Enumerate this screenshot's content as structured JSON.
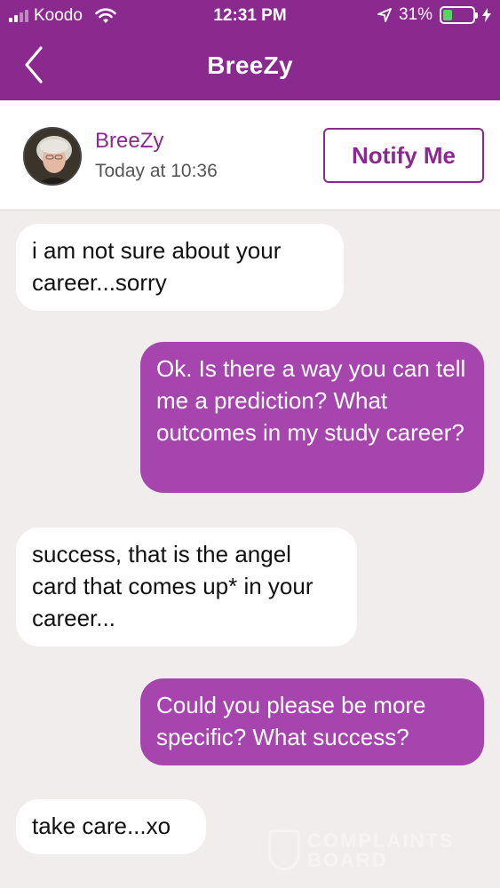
{
  "status_bar": {
    "carrier": "Koodo",
    "time": "12:31 PM",
    "battery_percent": "31%",
    "battery_level": 0.31,
    "icons": [
      "signal-icon",
      "wifi-icon",
      "location-arrow-icon",
      "battery-icon",
      "charging-bolt-icon"
    ]
  },
  "nav": {
    "title": "BreeZy",
    "back_icon": "chevron-left-icon"
  },
  "header": {
    "sender_name": "BreeZy",
    "timestamp": "Today at 10:36",
    "notify_label": "Notify Me"
  },
  "messages": [
    {
      "direction": "in",
      "text": "i am not sure about your career...sorry"
    },
    {
      "direction": "out",
      "text": "Ok. Is there a way you can tell me a prediction? What outcomes in my study career?"
    },
    {
      "direction": "in",
      "text": "success, that is the angel card that comes up* in your career..."
    },
    {
      "direction": "out",
      "text": "Could you please be more specific? What success?"
    },
    {
      "direction": "in",
      "text": "take care...xo"
    }
  ],
  "watermark": {
    "line1": "COMPLAINTS",
    "line2": "BOARD"
  },
  "colors": {
    "brand_purple": "#8b2a8e",
    "outgoing_bubble": "#a645ae",
    "incoming_bubble": "#ffffff",
    "chat_background": "#f2eded",
    "battery_green": "#4cd964"
  }
}
